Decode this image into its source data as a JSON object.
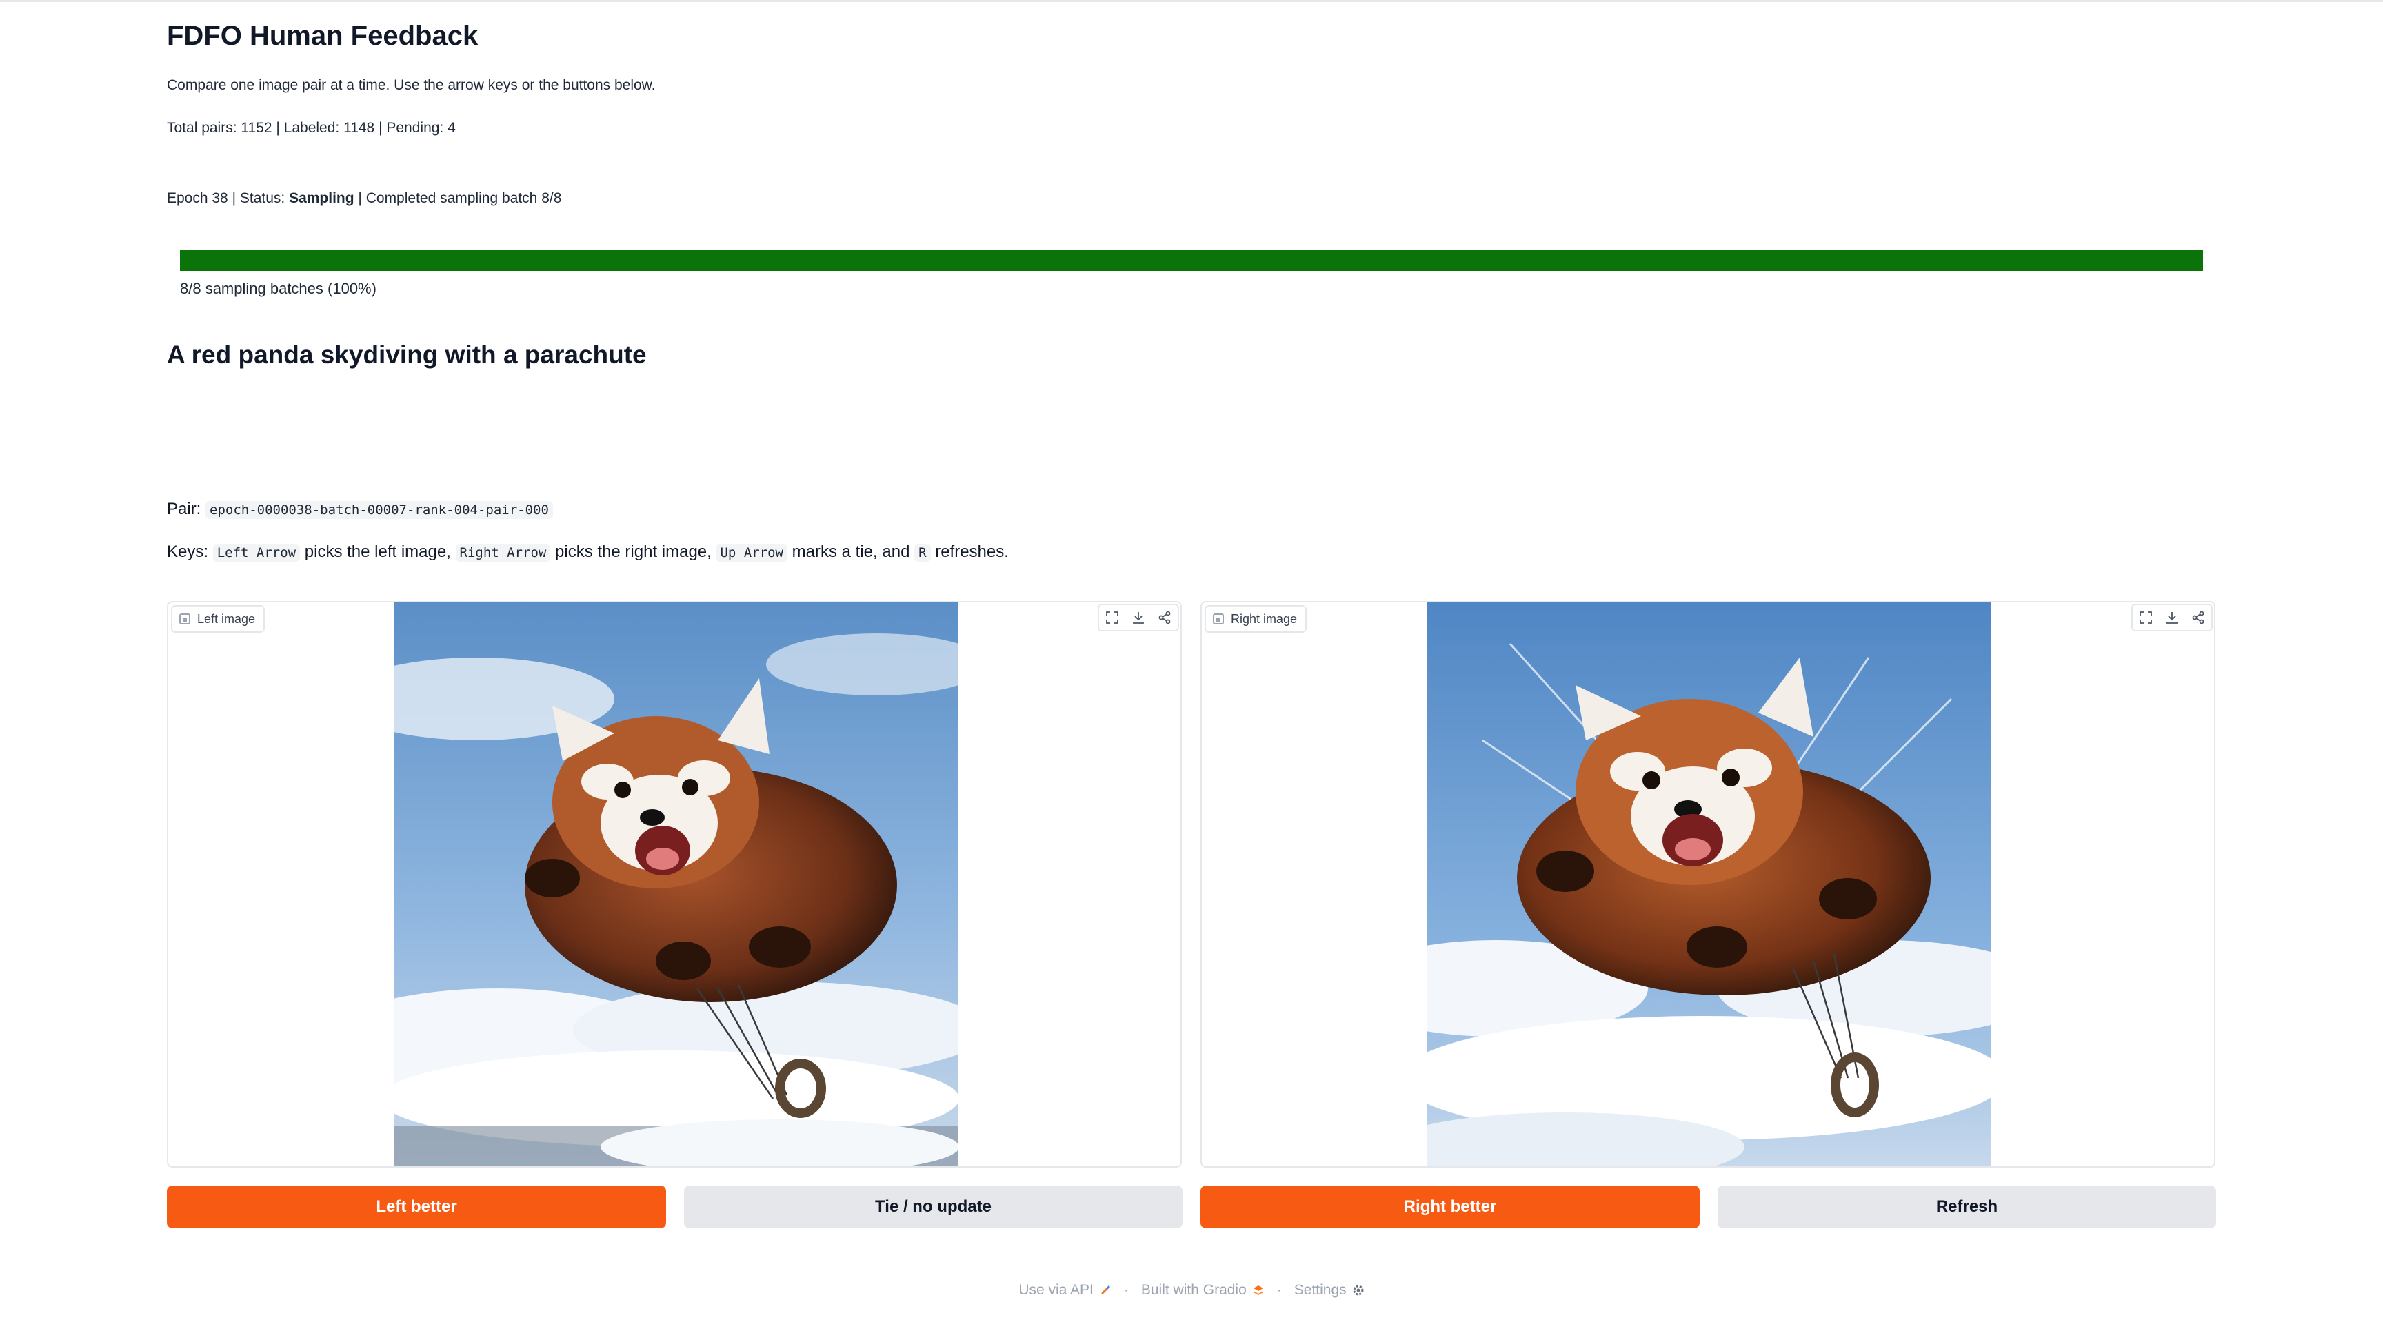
{
  "app": {
    "title": "FDFO Human Feedback",
    "description": "Compare one image pair at a time. Use the arrow keys or the buttons below.",
    "counts": "Total pairs: 1152 | Labeled: 1148 | Pending: 4"
  },
  "status": {
    "prefix": "Epoch 38 | Status: ",
    "state": "Sampling",
    "suffix": " | Completed sampling batch 8/8"
  },
  "progress": {
    "fraction": 1.0,
    "label": "8/8 sampling batches (100%)",
    "color": "#0a740a"
  },
  "prompt": "A red panda skydiving with a parachute",
  "pair": {
    "label": "Pair: ",
    "id": "epoch-0000038-batch-00007-rank-004-pair-000"
  },
  "keys": {
    "label": "Keys: ",
    "left_key": "Left Arrow",
    "left_text": " picks the left image, ",
    "right_key": "Right Arrow",
    "right_text": " picks the right image, ",
    "up_key": "Up Arrow",
    "up_text": " marks a tie, and ",
    "r_key": "R",
    "r_text": " refreshes."
  },
  "panels": {
    "left": {
      "label": "Left image",
      "image_icon": "image-icon"
    },
    "right": {
      "label": "Right image",
      "image_icon": "image-icon"
    },
    "tool_icons": [
      "fullscreen-icon",
      "download-icon",
      "share-icon"
    ]
  },
  "buttons": {
    "left_better": "Left better",
    "tie": "Tie / no update",
    "right_better": "Right better",
    "refresh": "Refresh"
  },
  "colors": {
    "primary": "#f75a13",
    "secondary": "#e5e7eb"
  },
  "footer": {
    "api": "Use via API",
    "built": "Built with Gradio",
    "settings": "Settings",
    "separator": "·"
  }
}
